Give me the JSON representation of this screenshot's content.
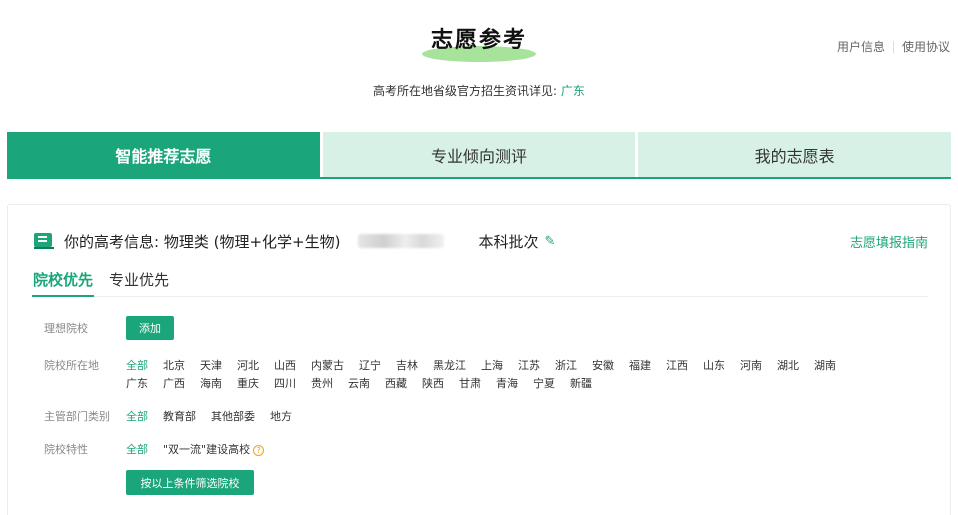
{
  "header": {
    "title": "志愿参考",
    "links": [
      "用户信息",
      "使用协议"
    ],
    "subtitle_prefix": "高考所在地省级官方招生资讯详见:",
    "subtitle_province": "广东"
  },
  "tabs": [
    {
      "label": "智能推荐志愿",
      "active": true
    },
    {
      "label": "专业倾向测评",
      "active": false
    },
    {
      "label": "我的志愿表",
      "active": false
    }
  ],
  "info": {
    "text": "你的高考信息: 物理类 (物理+化学+生物)",
    "batch": "本科批次",
    "guide_link": "志愿填报指南"
  },
  "subtabs": [
    {
      "label": "院校优先",
      "active": true
    },
    {
      "label": "专业优先",
      "active": false
    }
  ],
  "filters": {
    "ideal_label": "理想院校",
    "add_button": "添加",
    "location_label": "院校所在地",
    "locations_line1": [
      "全部",
      "北京",
      "天津",
      "河北",
      "山西",
      "内蒙古",
      "辽宁",
      "吉林",
      "黑龙江",
      "上海",
      "江苏",
      "浙江",
      "安徽",
      "福建",
      "江西",
      "山东",
      "河南",
      "湖北",
      "湖南"
    ],
    "locations_line2": [
      "广东",
      "广西",
      "海南",
      "重庆",
      "四川",
      "贵州",
      "云南",
      "西藏",
      "陕西",
      "甘肃",
      "青海",
      "宁夏",
      "新疆"
    ],
    "dept_label": "主管部门类别",
    "depts": [
      "全部",
      "教育部",
      "其他部委",
      "地方"
    ],
    "feature_label": "院校特性",
    "features": [
      "全部",
      "\"双一流\"建设高校"
    ],
    "filter_button": "按以上条件筛选院校"
  },
  "colors": {
    "accent": "#1aa67a",
    "tab_inactive_bg": "#d7f1e6",
    "title_highlight": "#a8e39c"
  }
}
